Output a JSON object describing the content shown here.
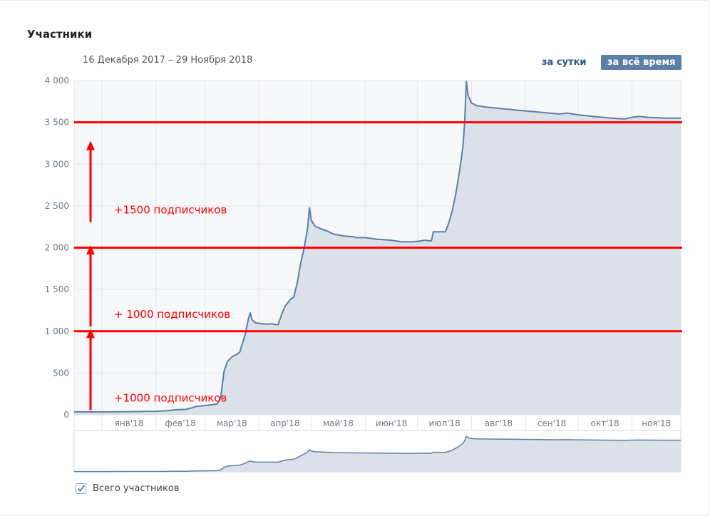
{
  "header": {
    "title": "Участники",
    "date_range": "16 Декабря 2017 – 29 Ноября 2018",
    "btn_day": "за сутки",
    "btn_all": "за всё время"
  },
  "legend": {
    "label": "Всего участников",
    "checked": true
  },
  "colors": {
    "line": "#5d7fa3",
    "fill": "#dae1e9",
    "annotation": "#ff0000",
    "active_button": "#5b7fa6",
    "link": "#2a5885"
  },
  "chart_data": {
    "type": "area",
    "ylim": [
      0,
      4000
    ],
    "y_ticks": [
      {
        "value": 0,
        "label": "0"
      },
      {
        "value": 500,
        "label": "500"
      },
      {
        "value": 1000,
        "label": "1 000"
      },
      {
        "value": 1500,
        "label": "1 500"
      },
      {
        "value": 2000,
        "label": "2 000"
      },
      {
        "value": 2500,
        "label": "2 500"
      },
      {
        "value": 3000,
        "label": "3 000"
      },
      {
        "value": 3500,
        "label": "3 500"
      },
      {
        "value": 4000,
        "label": "4 000"
      }
    ],
    "x_start": "2017-12-16",
    "x_end": "2018-11-29",
    "x_ticks": [
      {
        "date": "2018-01-01",
        "label": "янв'18"
      },
      {
        "date": "2018-02-01",
        "label": "фев'18"
      },
      {
        "date": "2018-03-01",
        "label": "мар'18"
      },
      {
        "date": "2018-04-01",
        "label": "апр'18"
      },
      {
        "date": "2018-05-01",
        "label": "май'18"
      },
      {
        "date": "2018-06-01",
        "label": "июн'18"
      },
      {
        "date": "2018-07-01",
        "label": "июл'18"
      },
      {
        "date": "2018-08-01",
        "label": "авг'18"
      },
      {
        "date": "2018-09-01",
        "label": "сен'18"
      },
      {
        "date": "2018-10-01",
        "label": "окт'18"
      },
      {
        "date": "2018-11-01",
        "label": "ноя'18"
      }
    ],
    "x_gridlines": [
      "2017-12-16",
      "2018-01-01",
      "2018-02-01",
      "2018-03-01",
      "2018-04-01",
      "2018-05-01",
      "2018-06-01",
      "2018-07-01",
      "2018-08-01",
      "2018-09-01",
      "2018-10-01",
      "2018-11-01",
      "2018-11-29"
    ],
    "series": [
      {
        "points": [
          [
            "2017-12-16",
            35
          ],
          [
            "2017-12-25",
            35
          ],
          [
            "2018-01-05",
            35
          ],
          [
            "2018-01-15",
            37
          ],
          [
            "2018-01-25",
            40
          ],
          [
            "2018-02-01",
            42
          ],
          [
            "2018-02-08",
            50
          ],
          [
            "2018-02-12",
            60
          ],
          [
            "2018-02-18",
            65
          ],
          [
            "2018-02-21",
            80
          ],
          [
            "2018-02-24",
            100
          ],
          [
            "2018-03-01",
            110
          ],
          [
            "2018-03-05",
            120
          ],
          [
            "2018-03-08",
            130
          ],
          [
            "2018-03-10",
            200
          ],
          [
            "2018-03-11",
            360
          ],
          [
            "2018-03-12",
            520
          ],
          [
            "2018-03-14",
            640
          ],
          [
            "2018-03-17",
            700
          ],
          [
            "2018-03-19",
            720
          ],
          [
            "2018-03-21",
            750
          ],
          [
            "2018-03-24",
            950
          ],
          [
            "2018-03-26",
            1150
          ],
          [
            "2018-03-27",
            1220
          ],
          [
            "2018-03-28",
            1140
          ],
          [
            "2018-03-30",
            1100
          ],
          [
            "2018-04-03",
            1090
          ],
          [
            "2018-04-06",
            1085
          ],
          [
            "2018-04-08",
            1090
          ],
          [
            "2018-04-10",
            1080
          ],
          [
            "2018-04-12",
            1080
          ],
          [
            "2018-04-14",
            1200
          ],
          [
            "2018-04-16",
            1300
          ],
          [
            "2018-04-19",
            1380
          ],
          [
            "2018-04-21",
            1410
          ],
          [
            "2018-04-23",
            1580
          ],
          [
            "2018-04-25",
            1820
          ],
          [
            "2018-04-27",
            2000
          ],
          [
            "2018-04-29",
            2250
          ],
          [
            "2018-04-30",
            2480
          ],
          [
            "2018-05-01",
            2330
          ],
          [
            "2018-05-03",
            2260
          ],
          [
            "2018-05-06",
            2230
          ],
          [
            "2018-05-10",
            2200
          ],
          [
            "2018-05-14",
            2160
          ],
          [
            "2018-05-20",
            2140
          ],
          [
            "2018-05-25",
            2130
          ],
          [
            "2018-05-27",
            2120
          ],
          [
            "2018-06-01",
            2120
          ],
          [
            "2018-06-08",
            2100
          ],
          [
            "2018-06-15",
            2090
          ],
          [
            "2018-06-22",
            2070
          ],
          [
            "2018-06-28",
            2070
          ],
          [
            "2018-07-03",
            2080
          ],
          [
            "2018-07-05",
            2090
          ],
          [
            "2018-07-08",
            2080
          ],
          [
            "2018-07-09",
            2085
          ],
          [
            "2018-07-10",
            2190
          ],
          [
            "2018-07-14",
            2190
          ],
          [
            "2018-07-17",
            2190
          ],
          [
            "2018-07-19",
            2300
          ],
          [
            "2018-07-21",
            2450
          ],
          [
            "2018-07-23",
            2650
          ],
          [
            "2018-07-25",
            2900
          ],
          [
            "2018-07-27",
            3200
          ],
          [
            "2018-07-28",
            3500
          ],
          [
            "2018-07-29",
            3990
          ],
          [
            "2018-07-30",
            3820
          ],
          [
            "2018-08-01",
            3730
          ],
          [
            "2018-08-04",
            3700
          ],
          [
            "2018-08-10",
            3680
          ],
          [
            "2018-08-20",
            3660
          ],
          [
            "2018-08-30",
            3640
          ],
          [
            "2018-09-10",
            3620
          ],
          [
            "2018-09-20",
            3600
          ],
          [
            "2018-09-25",
            3610
          ],
          [
            "2018-10-01",
            3590
          ],
          [
            "2018-10-10",
            3570
          ],
          [
            "2018-10-20",
            3550
          ],
          [
            "2018-10-28",
            3540
          ],
          [
            "2018-11-01",
            3560
          ],
          [
            "2018-11-05",
            3570
          ],
          [
            "2018-11-10",
            3560
          ],
          [
            "2018-11-20",
            3550
          ],
          [
            "2018-11-29",
            3550
          ]
        ]
      }
    ],
    "overlay_lines": [
      {
        "value": 3500
      },
      {
        "value": 2000
      },
      {
        "value": 1000
      }
    ],
    "annotations": [
      {
        "text": "+1500 подписчиков",
        "level": 2750
      },
      {
        "text": "+ 1000 подписчиков",
        "level": 1500
      },
      {
        "text": "+1000 подписчиков",
        "level": 500
      }
    ]
  }
}
